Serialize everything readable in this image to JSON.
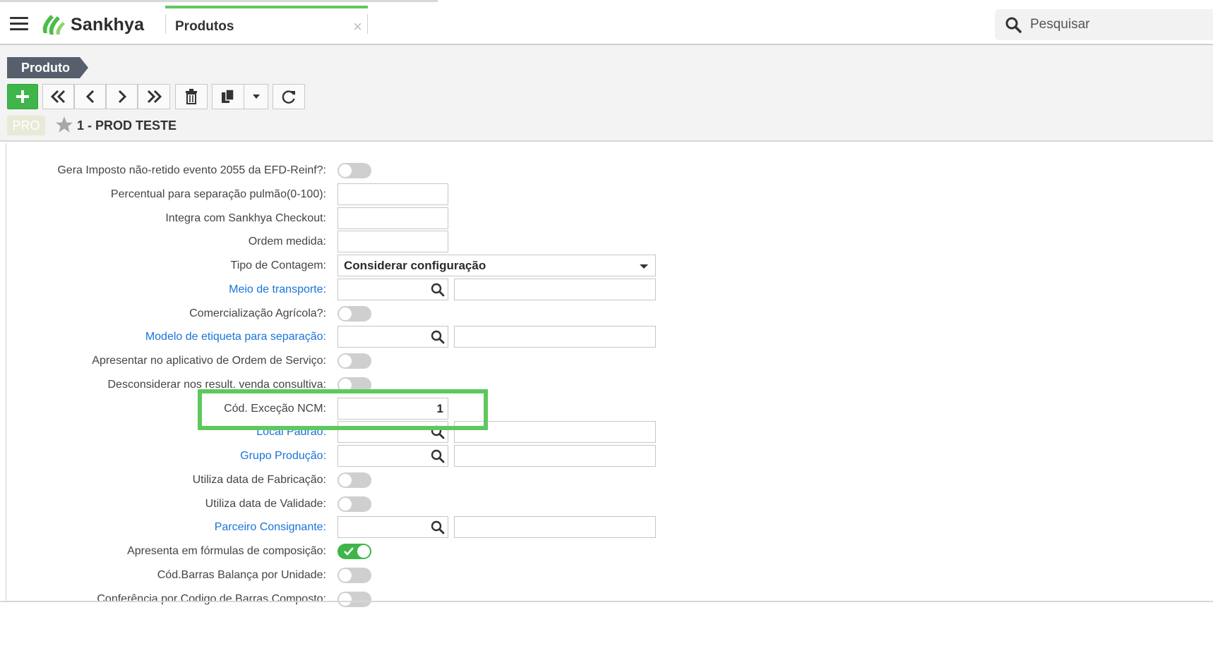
{
  "app": {
    "brand": "Sankhya",
    "tab_label": "Produtos",
    "tab_close": "×",
    "search_placeholder": "Pesquisar"
  },
  "header": {
    "breadcrumb": "Produto",
    "badge": "PRO",
    "record_title": "1 - PROD TESTE"
  },
  "colors": {
    "accent_green": "#3fb54a",
    "highlight_green": "#5ec85e",
    "link_blue": "#1a73d9",
    "breadcrumb_bg": "#565f6b"
  },
  "toolbar": {
    "icons": [
      "add-icon",
      "first-record-icon",
      "previous-record-icon",
      "next-record-icon",
      "last-record-icon",
      "delete-icon",
      "copy-icon",
      "dropdown-arrow-icon",
      "refresh-icon"
    ]
  },
  "form": {
    "fields": [
      {
        "label": "Gera Imposto não-retido evento 2055 da EFD-Reinf?:",
        "type": "toggle",
        "on": false
      },
      {
        "label": "Percentual para separação pulmão(0-100):",
        "type": "input",
        "value": ""
      },
      {
        "label": "Integra com Sankhya Checkout:",
        "type": "input",
        "value": ""
      },
      {
        "label": "Ordem medida:",
        "type": "input",
        "value": ""
      },
      {
        "label": "Tipo de Contagem:",
        "type": "select",
        "value": "Considerar configuração"
      },
      {
        "label": "Meio de transporte:",
        "type": "lookup",
        "link": true,
        "value": "",
        "description": ""
      },
      {
        "label": "Comercialização Agrícola?:",
        "type": "toggle",
        "on": false
      },
      {
        "label": "Modelo de etiqueta para separação:",
        "type": "lookup",
        "link": true,
        "value": "",
        "description": ""
      },
      {
        "label": "Apresentar no aplicativo de Ordem de Serviço:",
        "type": "toggle",
        "on": false
      },
      {
        "label": "Desconsiderar nos result. venda consultiva:",
        "type": "toggle",
        "on": false
      },
      {
        "label": "Cód. Exceção NCM:",
        "type": "number",
        "value": "1"
      },
      {
        "label": "Local Padrão:",
        "type": "lookup",
        "link": true,
        "value": "",
        "description": ""
      },
      {
        "label": "Grupo Produção:",
        "type": "lookup",
        "link": true,
        "value": "",
        "description": ""
      },
      {
        "label": "Utiliza data de Fabricação:",
        "type": "toggle",
        "on": false
      },
      {
        "label": "Utiliza data de Validade:",
        "type": "toggle",
        "on": false
      },
      {
        "label": "Parceiro Consignante:",
        "type": "lookup",
        "link": true,
        "value": "",
        "description": ""
      },
      {
        "label": "Apresenta em fórmulas de composição:",
        "type": "toggle",
        "on": true
      },
      {
        "label": "Cód.Barras Balança por Unidade:",
        "type": "toggle",
        "on": false
      },
      {
        "label": "Conferência por Codigo de Barras Composto:",
        "type": "toggle",
        "on": false
      }
    ]
  }
}
